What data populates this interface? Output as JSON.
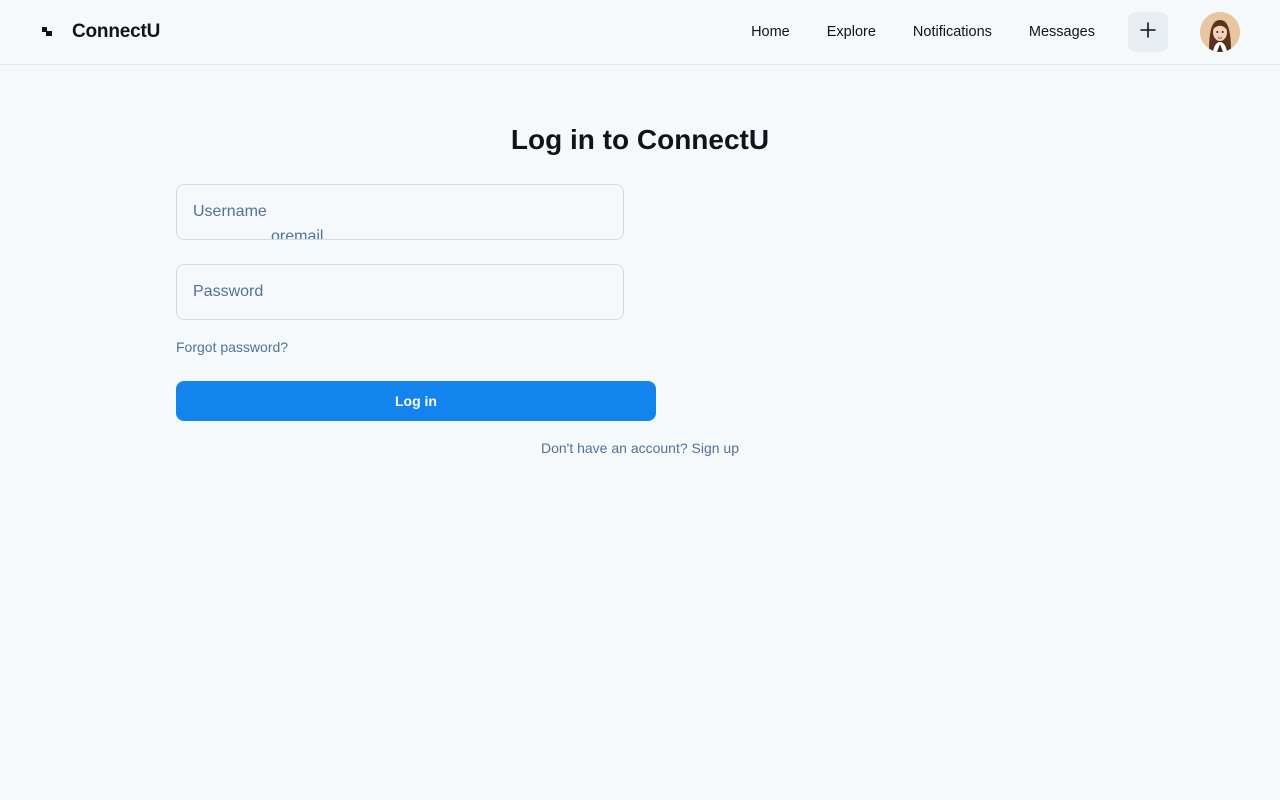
{
  "app": {
    "brand_name": "ConnectU"
  },
  "nav": {
    "items": [
      {
        "label": "Home"
      },
      {
        "label": "Explore"
      },
      {
        "label": "Notifications"
      },
      {
        "label": "Messages"
      }
    ],
    "add_icon": "plus-icon",
    "avatar_icon": "user-avatar"
  },
  "main": {
    "title": "Log in to ConnectU",
    "username": {
      "placeholder": "Username",
      "value": "",
      "overflow_text": "oremail"
    },
    "password": {
      "placeholder": "Password",
      "value": ""
    },
    "forgot_label": "Forgot password?",
    "login_label": "Log in",
    "signup_label": "Don't have an account? Sign up"
  },
  "colors": {
    "background": "#f6f9fc",
    "accent": "#1383ed",
    "muted_text": "#4f7396",
    "border": "#d1dbe6"
  }
}
